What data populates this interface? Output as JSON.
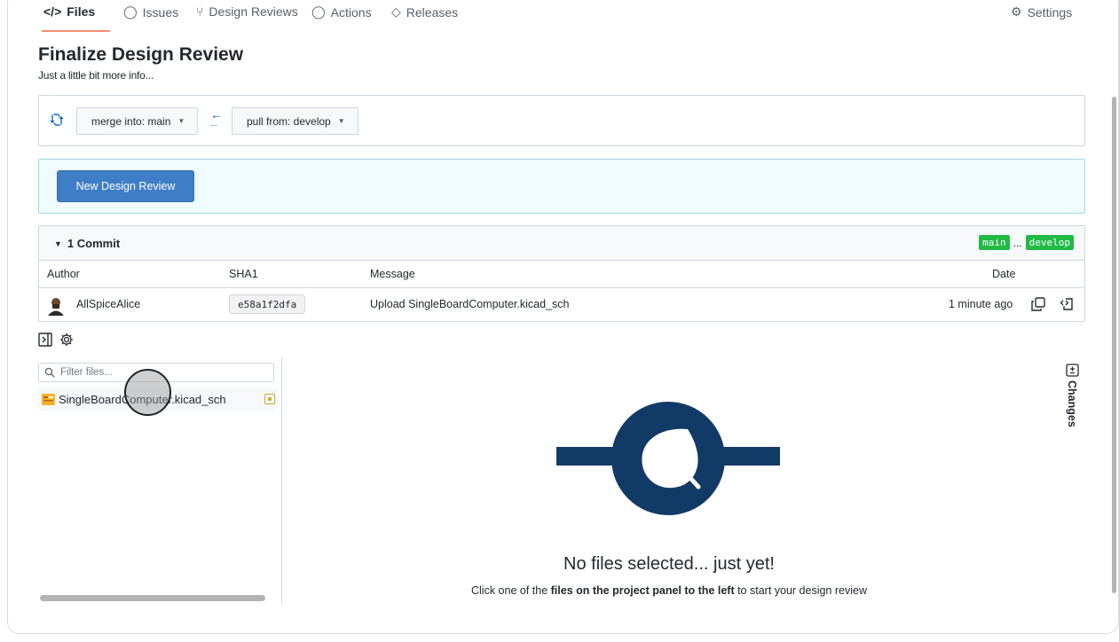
{
  "tabs": [
    {
      "label": "Files",
      "active": true
    },
    {
      "label": "Issues",
      "active": false
    },
    {
      "label": "Design Reviews",
      "active": false
    },
    {
      "label": "Actions",
      "active": false
    },
    {
      "label": "Releases",
      "active": false
    },
    {
      "label": "Settings",
      "active": false
    }
  ],
  "page": {
    "title": "Finalize Design Review",
    "subtitle": "Just a little bit more info..."
  },
  "branches": {
    "merge_into": "merge into: main",
    "pull_from": "pull from: develop"
  },
  "new_review_button": "New Design Review",
  "commits": {
    "header": "1 Commit",
    "base_badge": "main",
    "separator": "...",
    "head_badge": "develop",
    "columns": {
      "author": "Author",
      "sha": "SHA1",
      "message": "Message",
      "date": "Date"
    },
    "rows": [
      {
        "author": "AllSpiceAlice",
        "sha": "e58a1f2dfa",
        "message": "Upload SingleBoardComputer.kicad_sch",
        "date": "1 minute ago"
      }
    ]
  },
  "files_panel": {
    "filter_placeholder": "Filter files...",
    "files": [
      {
        "name": "SingleBoardComputer.kicad_sch",
        "status": "modified"
      }
    ]
  },
  "changes_label": "Changes",
  "empty_state": {
    "title": "No files selected... just yet!",
    "text_before": "Click one of the ",
    "text_bold": "files on the project panel to the left",
    "text_after": " to start your design review"
  },
  "colors": {
    "accent_blue": "#3f7ec6",
    "badge_green": "#21ba45",
    "illustration_navy": "#123a66",
    "info_bg": "#f0fbfd"
  }
}
